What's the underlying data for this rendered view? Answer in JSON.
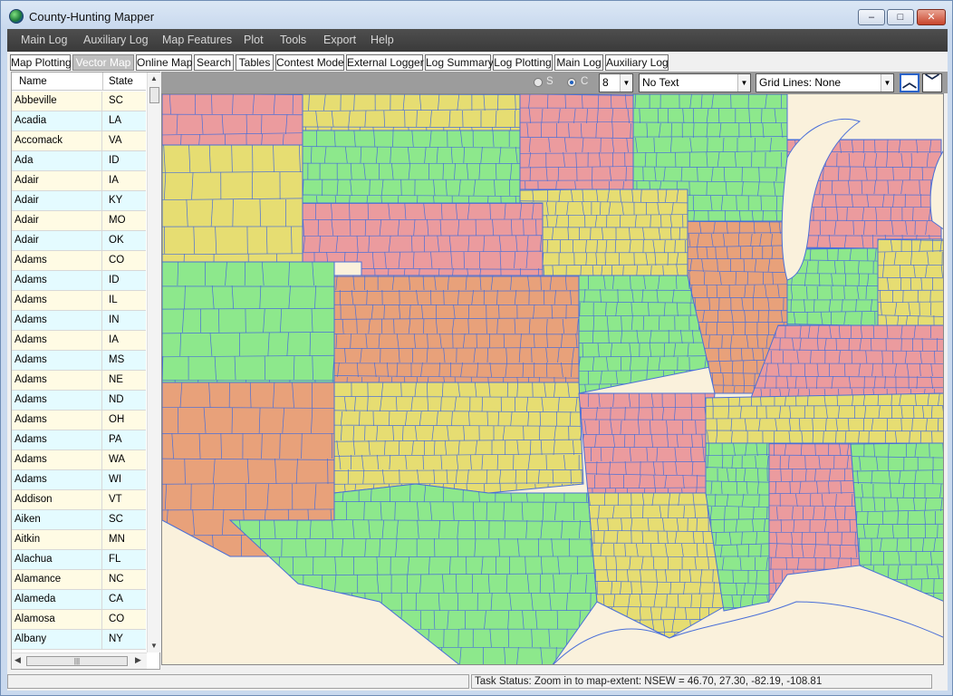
{
  "app": {
    "title": "County-Hunting Mapper"
  },
  "window_controls": {
    "minimize": "–",
    "maximize": "□",
    "close": "✕"
  },
  "menubar": {
    "items": [
      "Main Log",
      "Auxiliary Log",
      "Map Features",
      "Plot",
      "Tools",
      "Export",
      "Help"
    ]
  },
  "tabs": {
    "active": "Vector Map",
    "items": [
      "Map Plotting",
      "Vector Map",
      "Online Map",
      "Search",
      "Tables",
      "Contest Mode",
      "External Logger",
      "Log Summary",
      "Log Plotting",
      "Main Log",
      "Auxiliary Log"
    ]
  },
  "county_list": {
    "columns": [
      "Name",
      "State"
    ],
    "rows": [
      [
        "Abbeville",
        "SC"
      ],
      [
        "Acadia",
        "LA"
      ],
      [
        "Accomack",
        "VA"
      ],
      [
        "Ada",
        "ID"
      ],
      [
        "Adair",
        "IA"
      ],
      [
        "Adair",
        "KY"
      ],
      [
        "Adair",
        "MO"
      ],
      [
        "Adair",
        "OK"
      ],
      [
        "Adams",
        "CO"
      ],
      [
        "Adams",
        "ID"
      ],
      [
        "Adams",
        "IL"
      ],
      [
        "Adams",
        "IN"
      ],
      [
        "Adams",
        "IA"
      ],
      [
        "Adams",
        "MS"
      ],
      [
        "Adams",
        "NE"
      ],
      [
        "Adams",
        "ND"
      ],
      [
        "Adams",
        "OH"
      ],
      [
        "Adams",
        "PA"
      ],
      [
        "Adams",
        "WA"
      ],
      [
        "Adams",
        "WI"
      ],
      [
        "Addison",
        "VT"
      ],
      [
        "Aiken",
        "SC"
      ],
      [
        "Aitkin",
        "MN"
      ],
      [
        "Alachua",
        "FL"
      ],
      [
        "Alamance",
        "NC"
      ],
      [
        "Alameda",
        "CA"
      ],
      [
        "Alamosa",
        "CO"
      ],
      [
        "Albany",
        "NY"
      ]
    ],
    "row_colors": {
      "even": "#fffbe4",
      "odd": "#e4fbff"
    }
  },
  "map_toolbar": {
    "radio_s": {
      "label": "S",
      "selected": false
    },
    "radio_c": {
      "label": "C",
      "selected": true
    },
    "size_value": "8",
    "text_mode": "No Text",
    "grid_lines": "Grid Lines: None"
  },
  "map": {
    "background": "#faf1dc",
    "border_color": "#4a6fd8",
    "palette": {
      "green": "#8de88c",
      "pink": "#eb9b9e",
      "yellow": "#e6dd72",
      "orange": "#e8a17a"
    }
  },
  "status": {
    "left": "",
    "task": "Task Status: Zoom in to map-extent: NSEW = 46.70, 27.30, -82.19, -108.81"
  }
}
